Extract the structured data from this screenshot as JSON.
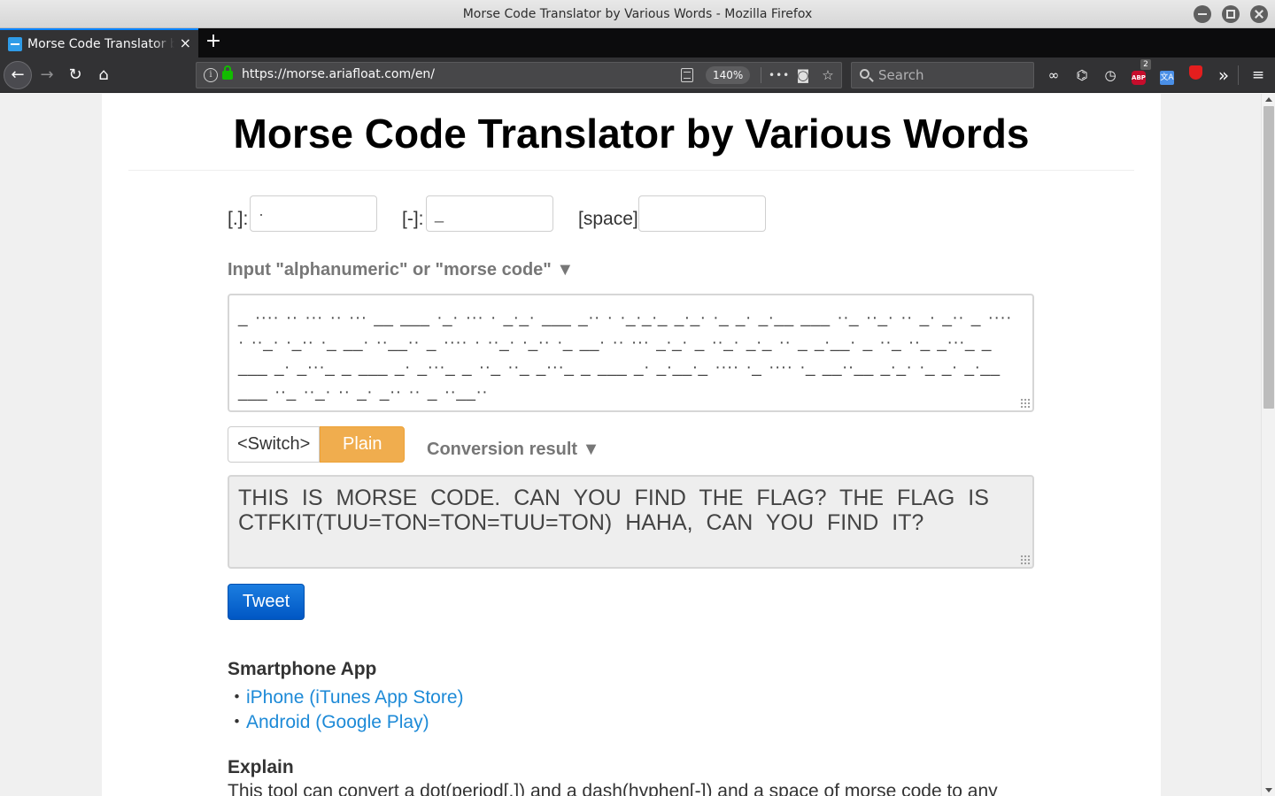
{
  "window": {
    "title": "Morse Code Translator by Various Words - Mozilla Firefox"
  },
  "tab": {
    "label": "Morse Code Translator by Various Words",
    "close": "×",
    "new_tab": "+"
  },
  "navbar": {
    "url": "https://morse.ariafloat.com/en/",
    "zoom": "140%",
    "search_placeholder": "Search",
    "more_actions": "•••",
    "badge_count": "2",
    "abp_text": "ABP",
    "translate_text": "文A"
  },
  "page": {
    "title": "Morse Code Translator by Various Words",
    "dot_label": "[.]:",
    "dot_value": "·",
    "dash_label": "[-]:",
    "dash_value": "_",
    "space_label": "[space]",
    "space_value": "",
    "input_toggle": "Input \"alphanumeric\" or \"morse code\" ▼",
    "morse_input": "_ ···· ·· ···   ·· ···   __ ___ ·_· ··· ·   _·_· ___ _·· · ·_·_·_   _·_· ·_ _·   _·__ ___ ··_   ··_· ·· _· _··   _ ···· ·   ··_· ·_·· ·_ __· ··__··   _ ···· ·   ··_· ·_·· ·_ __·   ·· ···   _·_· _ ··_· _·_ ·· _ _·__· _ ··_ ··_ _···_ _ ___ _· _···_ _ ___ _· _···_ _ ··_ ··_ _···_ _ ___ _· _·__·_   ···· ·_ ···· ·_ __··__   _·_· ·_ _·   _·__ ___ ··_   ··_· ·· _· _··   ·· _ ··__··",
    "switch_label": "<Switch>",
    "plain_label": "Plain",
    "result_toggle": "Conversion result ▼",
    "result_text": "THIS IS MORSE CODE. CAN YOU FIND THE FLAG? THE FLAG IS CTFKIT(TUU=TON=TON=TUU=TON) HAHA, CAN YOU FIND IT?",
    "tweet_label": "Tweet",
    "app_heading": "Smartphone App",
    "bullet": "・",
    "iphone_link": "iPhone (iTunes App Store)",
    "android_link": "Android (Google Play)",
    "explain_heading": "Explain",
    "explain_text": "This tool can convert a dot(period[.]) and a dash(hyphen[-]) and a space of morse code to any"
  },
  "colors": {
    "accent_plain": "#f0ad4e",
    "tweet": "#0a6fd8",
    "link": "#1d8ad7",
    "firefox_dark": "#323234"
  },
  "icons": [
    "back-arrow-icon",
    "forward-arrow-icon",
    "reload-icon",
    "home-icon",
    "info-icon",
    "lock-icon",
    "reader-view-icon",
    "page-actions-icon",
    "pocket-icon",
    "bookmark-star-icon",
    "search-icon",
    "mask-icon",
    "library-icon",
    "history-icon",
    "adblock-icon",
    "translate-icon",
    "ublock-icon",
    "overflow-icon",
    "hamburger-menu-icon"
  ]
}
